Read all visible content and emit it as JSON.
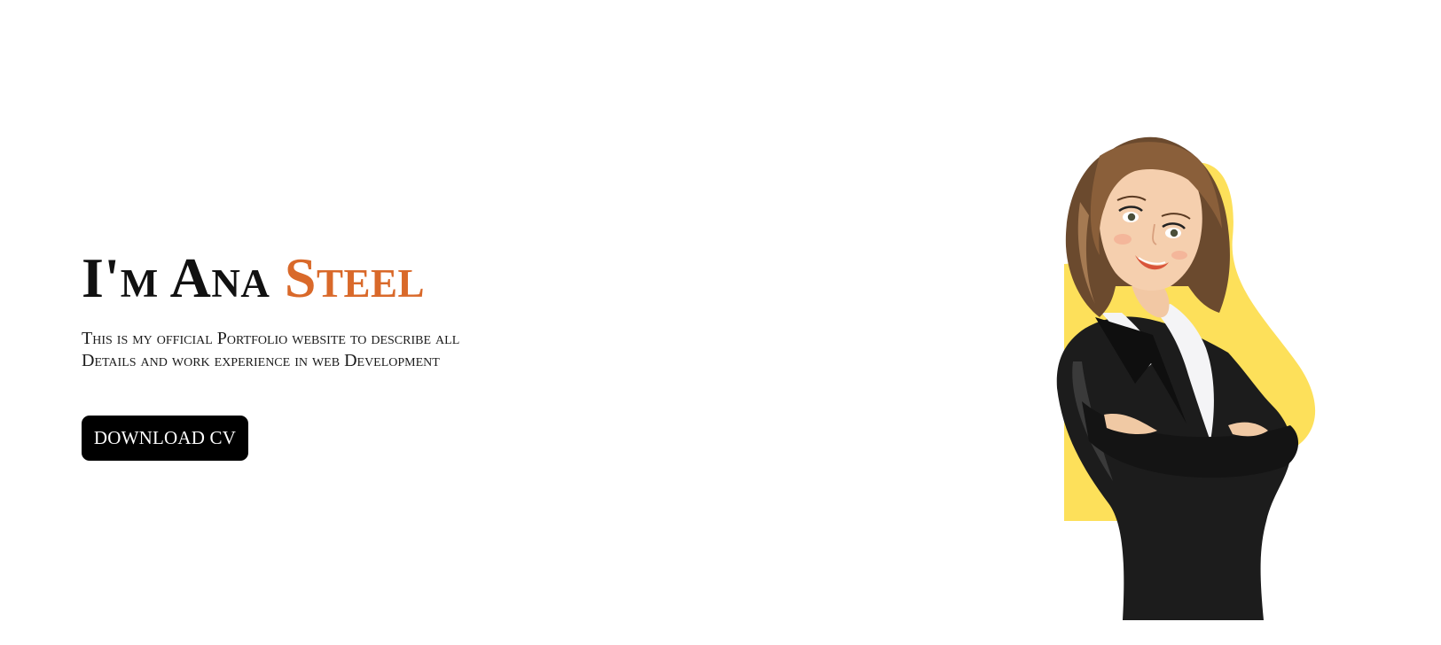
{
  "hero": {
    "title_prefix": "I'm Ana ",
    "title_accent": "Steel",
    "description_line1": "This is my official Portfolio website to describe all",
    "description_line2": "Details and work experience in web Development",
    "download_label": "DOWNLOAD CV"
  },
  "colors": {
    "accent": "#d9692a",
    "button_bg": "#000000",
    "blob": "#fde05a"
  },
  "illustration": {
    "icon": "businesswoman-portrait-illustration"
  }
}
